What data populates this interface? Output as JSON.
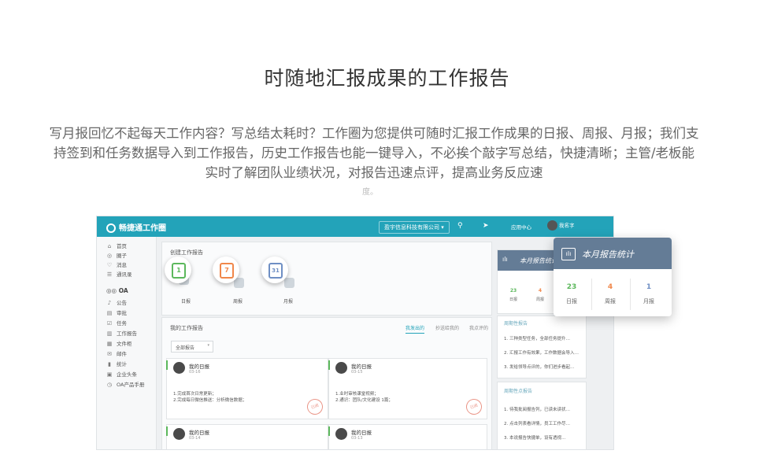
{
  "page": {
    "title": "时随地汇报成果的工作报告",
    "description": "写月报回忆不起每天工作内容？写总结太耗时？工作圈为您提供可随时汇报工作成果的日报、周报、月报；我们支持签到和任务数据导入到工作报告，历史工作报告也能一键导入，不必挨个敲字写总结，快捷清晰；主管/老板能实时了解团队业绩状况，对报告迅速点评，提高业务反应速",
    "description_tail": "度。"
  },
  "app": {
    "logo_text": "畅捷通工作圈",
    "company": "盈宇信息科技有限公司",
    "company_caret": "▾",
    "search_icon": "⚲",
    "send_icon": "➤",
    "app_center": "应用中心",
    "user_name": "我名字"
  },
  "sidebar": {
    "items": [
      {
        "icon": "⌂",
        "label": "首页"
      },
      {
        "icon": "◎",
        "label": "圈子"
      },
      {
        "icon": "♡",
        "label": "消息"
      },
      {
        "icon": "☰",
        "label": "通讯录"
      }
    ],
    "oa_label": "OA",
    "oa_items": [
      {
        "icon": "♪",
        "label": "公告"
      },
      {
        "icon": "▤",
        "label": "审批"
      },
      {
        "icon": "☑",
        "label": "任务"
      },
      {
        "icon": "▥",
        "label": "工作报告"
      },
      {
        "icon": "▦",
        "label": "文件柜"
      },
      {
        "icon": "✉",
        "label": "邮件"
      },
      {
        "icon": "▮",
        "label": "统计"
      },
      {
        "icon": "▣",
        "label": "企业头条"
      },
      {
        "icon": "◷",
        "label": "OA产品手册"
      }
    ]
  },
  "create": {
    "title": "创建工作报告",
    "types": [
      {
        "glyph": "1",
        "label": "日报",
        "color": "#5cb85c"
      },
      {
        "glyph": "7",
        "label": "周报",
        "color": "#f0874a"
      },
      {
        "glyph": "31",
        "label": "月报",
        "color": "#6f8fc4"
      }
    ]
  },
  "my_reports": {
    "title": "我的工作报告",
    "tabs": [
      "我发出的",
      "抄送给我的",
      "我点评的"
    ],
    "filter": "全部报告",
    "filter_caret": "▾",
    "cards": [
      {
        "name": "我的日报",
        "date": "03-16",
        "line1": "1.完成首次日常更新；",
        "line2": "2.完成每日微信推送：分析微信数据；",
        "stamp": "已阅"
      },
      {
        "name": "我的日报",
        "date": "03-15",
        "line1": "1.业时审核课堂视频；",
        "line2": "2.通识：团队/文化建设 1篇；",
        "stamp": "已阅"
      },
      {
        "name": "我的日报",
        "date": "03-14",
        "line1": "",
        "line2": "",
        "stamp": ""
      },
      {
        "name": "我的日报",
        "date": "03-13",
        "line1": "",
        "line2": "",
        "stamp": ""
      }
    ]
  },
  "right_panel": {
    "title": "本月报告统计",
    "stats": [
      {
        "value": "23",
        "label": "日报",
        "color": "#5cb85c"
      },
      {
        "value": "4",
        "label": "周报",
        "color": "#f0874a"
      }
    ],
    "list1_title": "周期性报告",
    "list1": [
      "1. 三种类型任务，全部任务提升…",
      "2. 汇报工作有效果，工作数据会导入…",
      "3. 发给领导点评的，你们进步看起…"
    ],
    "list2_title": "周期性点报告",
    "list2": [
      "1. 待我批阅报告列，已读未读状…",
      "2. 点击列表看详情，员工工作尽…",
      "3. 本说报告快捷单，设有透视…"
    ]
  },
  "popup": {
    "title": "本月报告统计",
    "icon": "ılı",
    "stats": [
      {
        "value": "23",
        "label": "日报",
        "color": "#5cb85c"
      },
      {
        "value": "4",
        "label": "周报",
        "color": "#f0874a"
      },
      {
        "value": "1",
        "label": "月报",
        "color": "#6f8fc4"
      }
    ]
  }
}
